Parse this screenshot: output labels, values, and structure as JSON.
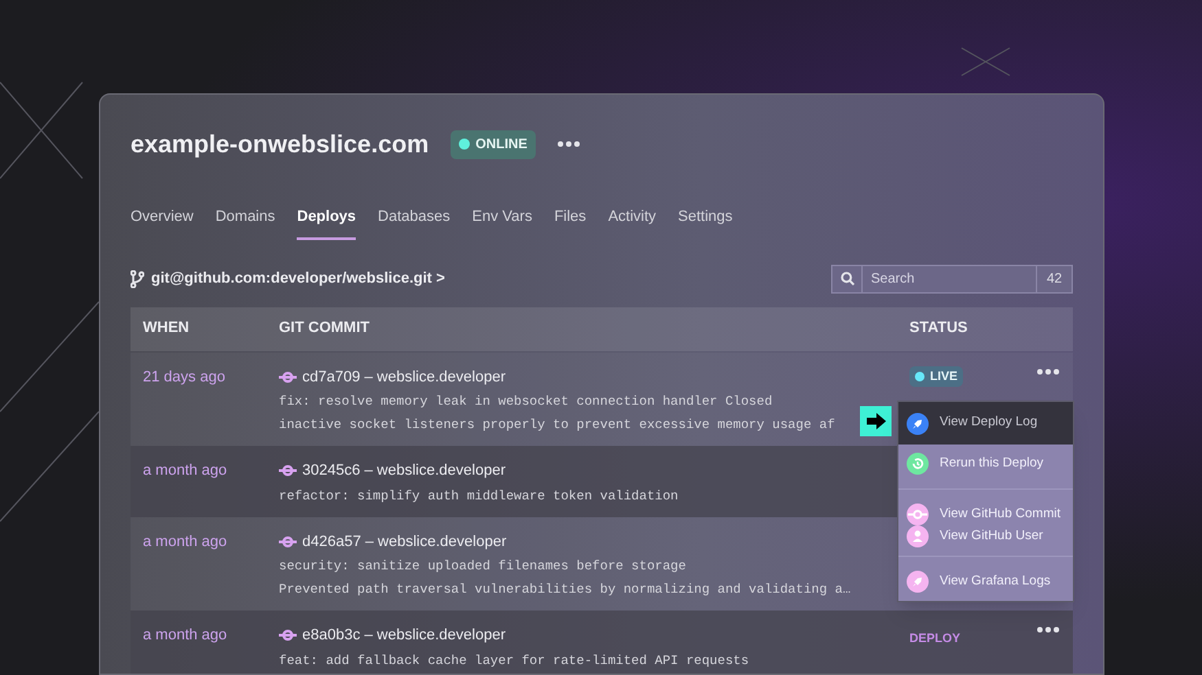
{
  "site": {
    "title": "example-onwebslice.com",
    "status": "ONLINE"
  },
  "tabs": [
    {
      "label": "Overview",
      "selected": false
    },
    {
      "label": "Domains",
      "selected": false
    },
    {
      "label": "Deploys",
      "selected": true
    },
    {
      "label": "Databases",
      "selected": false
    },
    {
      "label": "Env Vars",
      "selected": false
    },
    {
      "label": "Files",
      "selected": false
    },
    {
      "label": "Activity",
      "selected": false
    },
    {
      "label": "Settings",
      "selected": false
    }
  ],
  "repo": "git@github.com:developer/webslice.git >",
  "search": {
    "placeholder": "Search",
    "count": "42"
  },
  "table": {
    "columns": [
      "WHEN",
      "GIT COMMIT",
      "STATUS"
    ],
    "rows": [
      {
        "when": "21 days ago",
        "commit": "cd7a709 – webslice.developer",
        "lines": [
          "fix: resolve memory leak in websocket connection handler Closed",
          "inactive socket listeners properly to prevent excessive memory usage af"
        ],
        "status": {
          "kind": "live",
          "label": "LIVE"
        }
      },
      {
        "when": "a month ago",
        "commit": "30245c6 – webslice.developer",
        "lines": [
          "refactor: simplify auth middleware token validation"
        ]
      },
      {
        "when": "a month ago",
        "commit": "d426a57 – webslice.developer",
        "lines": [
          "security: sanitize uploaded filenames before storage",
          "Prevented path traversal vulnerabilities by normalizing and validating a…"
        ]
      },
      {
        "when": "a month ago",
        "commit": "e8a0b3c – webslice.developer",
        "lines": [
          "feat: add fallback cache layer for rate-limited API requests"
        ],
        "status": {
          "kind": "text",
          "label": "DEPLOY"
        }
      }
    ]
  },
  "menu": {
    "groups": [
      [
        {
          "label": "View Deploy Log",
          "kind": "rocket",
          "color": "#3b82f6",
          "highlighted": true
        },
        {
          "label": "Rerun this Deploy",
          "kind": "rerun",
          "color": "#6ee7a0",
          "highlighted": false
        }
      ],
      [
        {
          "label": "View GitHub Commit",
          "kind": "commit",
          "color": "#f5b4f0",
          "highlighted": false
        },
        {
          "label": "View GitHub User",
          "kind": "user",
          "color": "#f5b4f0",
          "highlighted": false
        }
      ],
      [
        {
          "label": "View Grafana Logs",
          "kind": "rocket",
          "color": "#f5b4f0",
          "highlighted": false
        }
      ]
    ]
  }
}
